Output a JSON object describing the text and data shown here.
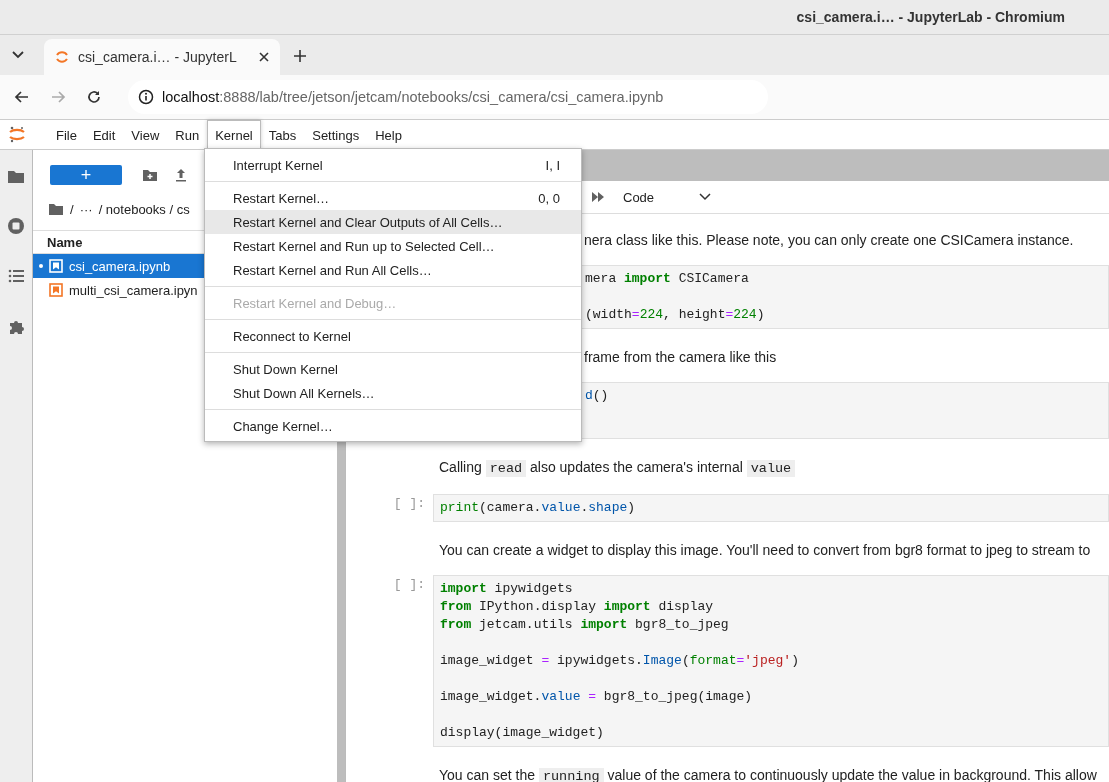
{
  "window": {
    "title": "csi_camera.i… - JupyterLab - Chromium"
  },
  "browser": {
    "tabs": [
      {
        "title": "csi_camera.i… - JupyterL",
        "selected": true
      }
    ],
    "url": "**localhost**:8888/lab/tree/jetson/jetcam/notebooks/csi_camera/csi_camera.ipynb"
  },
  "menubar": [
    {
      "label": "File",
      "selected": false
    },
    {
      "label": "Edit",
      "selected": false
    },
    {
      "label": "View",
      "selected": false
    },
    {
      "label": "Run",
      "selected": false
    },
    {
      "label": "Kernel",
      "selected": true
    },
    {
      "label": "Tabs",
      "selected": false
    },
    {
      "label": "Settings",
      "selected": false
    },
    {
      "label": "Help",
      "selected": false
    }
  ],
  "file_browser": {
    "new_button": "+",
    "breadcrumb": [
      "/",
      "···",
      "/ notebooks / cs"
    ],
    "column": "Name",
    "files": [
      {
        "name": "csi_camera.ipynb",
        "selected": true,
        "running": true,
        "color": "#ffffff"
      },
      {
        "name": "multi_csi_camera.ipyn",
        "selected": false,
        "running": false,
        "color": "#f37626"
      }
    ]
  },
  "notebook": {
    "cell_type": "Code",
    "cells": [
      {
        "kind": "markdown",
        "text": [
          {
            "text": "nera class like this. Please note, you can only create one CSICamera instance.",
            "kind": "plain"
          }
        ]
      },
      {
        "kind": "code",
        "blocks": [
          [
            [
              {
                "text": "mera ",
                "kind": "plain"
              },
              {
                "text": "import",
                "kind": "kw"
              },
              {
                "text": " CSICamera",
                "kind": "plain"
              }
            ]
          ],
          [
            [
              {
                "text": "(width",
                "kind": "plain"
              },
              {
                "text": "=",
                "kind": "op"
              },
              {
                "text": "224",
                "kind": "num"
              },
              {
                "text": ", height",
                "kind": "plain"
              },
              {
                "text": "=",
                "kind": "op"
              },
              {
                "text": "224",
                "kind": "num"
              },
              {
                "text": ")",
                "kind": "plain"
              }
            ]
          ]
        ]
      },
      {
        "kind": "markdown",
        "text": [
          {
            "text": "frame from the camera like this",
            "kind": "plain"
          }
        ]
      },
      {
        "kind": "code",
        "blocks": [
          [
            [
              {
                "text": "d",
                "kind": "attr"
              },
              {
                "text": "()",
                "kind": "plain"
              }
            ]
          ]
        ]
      },
      {
        "kind": "markdown",
        "text": [
          {
            "text": "Calling ",
            "kind": "plain"
          },
          {
            "text": "read",
            "kind": "code"
          },
          {
            "text": " also updates the camera's internal ",
            "kind": "plain"
          },
          {
            "text": "value",
            "kind": "code"
          }
        ]
      },
      {
        "kind": "code",
        "prompt": "[ ]:",
        "blocks": [
          [
            [
              {
                "text": "print",
                "kind": "builtin"
              },
              {
                "text": "(camera.",
                "kind": "plain"
              },
              {
                "text": "value",
                "kind": "attr"
              },
              {
                "text": ".",
                "kind": "plain"
              },
              {
                "text": "shape",
                "kind": "attr"
              },
              {
                "text": ")",
                "kind": "plain"
              }
            ]
          ]
        ]
      },
      {
        "kind": "markdown",
        "text": [
          {
            "text": "You can create a widget to display this image. You'll need to convert from bgr8 format to jpeg to stream to",
            "kind": "plain"
          }
        ]
      },
      {
        "kind": "code",
        "prompt": "[ ]:",
        "blocks": [
          [
            [
              {
                "text": "import",
                "kind": "kw"
              },
              {
                "text": " ipywidgets",
                "kind": "plain"
              }
            ],
            [
              {
                "text": "from",
                "kind": "kw"
              },
              {
                "text": " IPython.display ",
                "kind": "plain"
              },
              {
                "text": "import",
                "kind": "kw"
              },
              {
                "text": " display",
                "kind": "plain"
              }
            ],
            [
              {
                "text": "from",
                "kind": "kw"
              },
              {
                "text": " jetcam.utils ",
                "kind": "plain"
              },
              {
                "text": "import",
                "kind": "kw"
              },
              {
                "text": " bgr8_to_jpeg",
                "kind": "plain"
              }
            ]
          ],
          [
            [
              {
                "text": "image_widget ",
                "kind": "plain"
              },
              {
                "text": "=",
                "kind": "op"
              },
              {
                "text": " ipywidgets.",
                "kind": "plain"
              },
              {
                "text": "Image",
                "kind": "attr"
              },
              {
                "text": "(",
                "kind": "plain"
              },
              {
                "text": "format",
                "kind": "builtin"
              },
              {
                "text": "=",
                "kind": "op"
              },
              {
                "text": "'jpeg'",
                "kind": "str"
              },
              {
                "text": ")",
                "kind": "plain"
              }
            ]
          ],
          [
            [
              {
                "text": "image_widget.",
                "kind": "plain"
              },
              {
                "text": "value",
                "kind": "attr"
              },
              {
                "text": " =",
                "kind": "op"
              },
              {
                "text": " bgr8_to_jpeg(image)",
                "kind": "plain"
              }
            ]
          ],
          [
            [
              {
                "text": "display(image_widget)",
                "kind": "plain"
              }
            ]
          ]
        ]
      },
      {
        "kind": "markdown",
        "text": [
          {
            "text": "You can set the ",
            "kind": "plain"
          },
          {
            "text": "running",
            "kind": "code"
          },
          {
            "text": " value of the camera to continuously update the value in background. This allow",
            "kind": "plain"
          }
        ]
      }
    ]
  },
  "kernel_menu": {
    "groups": [
      [
        {
          "label": "Interrupt Kernel",
          "shortcut": "I, I",
          "selected": false,
          "disabled": false
        }
      ],
      [
        {
          "label": "Restart Kernel…",
          "shortcut": "0, 0",
          "selected": false,
          "disabled": false
        },
        {
          "label": "Restart Kernel and Clear Outputs of All Cells…",
          "selected": true,
          "disabled": false
        },
        {
          "label": "Restart Kernel and Run up to Selected Cell…",
          "selected": false,
          "disabled": false
        },
        {
          "label": "Restart Kernel and Run All Cells…",
          "selected": false,
          "disabled": false
        }
      ],
      [
        {
          "label": "Restart Kernel and Debug…",
          "selected": false,
          "disabled": true
        }
      ],
      [
        {
          "label": "Reconnect to Kernel",
          "selected": false,
          "disabled": false
        }
      ],
      [
        {
          "label": "Shut Down Kernel",
          "selected": false,
          "disabled": false
        },
        {
          "label": "Shut Down All Kernels…",
          "selected": false,
          "disabled": false
        }
      ],
      [
        {
          "label": "Change Kernel…",
          "selected": false,
          "disabled": false
        }
      ]
    ]
  }
}
